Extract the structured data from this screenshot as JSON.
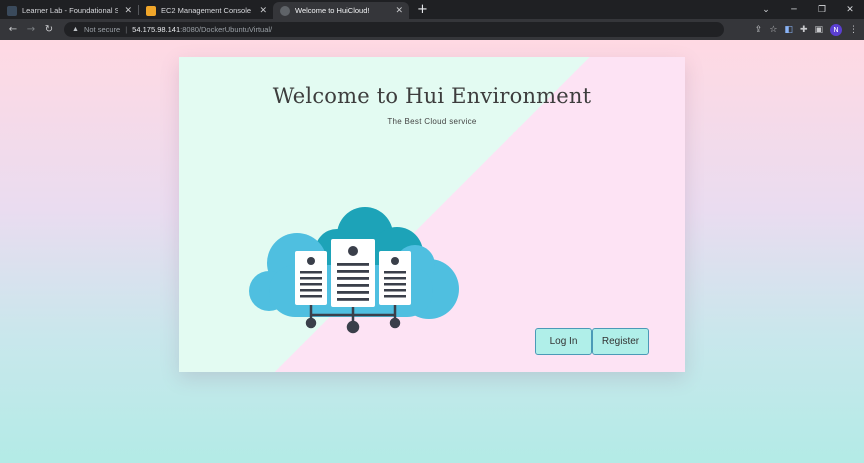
{
  "tabs": [
    {
      "title": "Learner Lab - Foundational Servi",
      "icon": "aws-academy-icon",
      "active": false
    },
    {
      "title": "EC2 Management Console",
      "icon": "aws-box-icon",
      "active": false
    },
    {
      "title": "Welcome to HuiCloud!",
      "icon": "globe-icon",
      "active": true
    }
  ],
  "address": {
    "security": "Not secure",
    "host": "54.175.98.141",
    "path": ":8080/DockerUbuntuVirtual/"
  },
  "profile": {
    "initial": "N",
    "color": "#5b3fd1"
  },
  "page": {
    "heading": "Welcome to Hui Environment",
    "subheading": "The Best Cloud service",
    "login_label": "Log In",
    "register_label": "Register"
  },
  "colors": {
    "button_fill": "#b0efe9",
    "button_border": "#4b9ab7",
    "cloud_light": "#4fbfe0",
    "cloud_dark": "#1da3b8"
  }
}
